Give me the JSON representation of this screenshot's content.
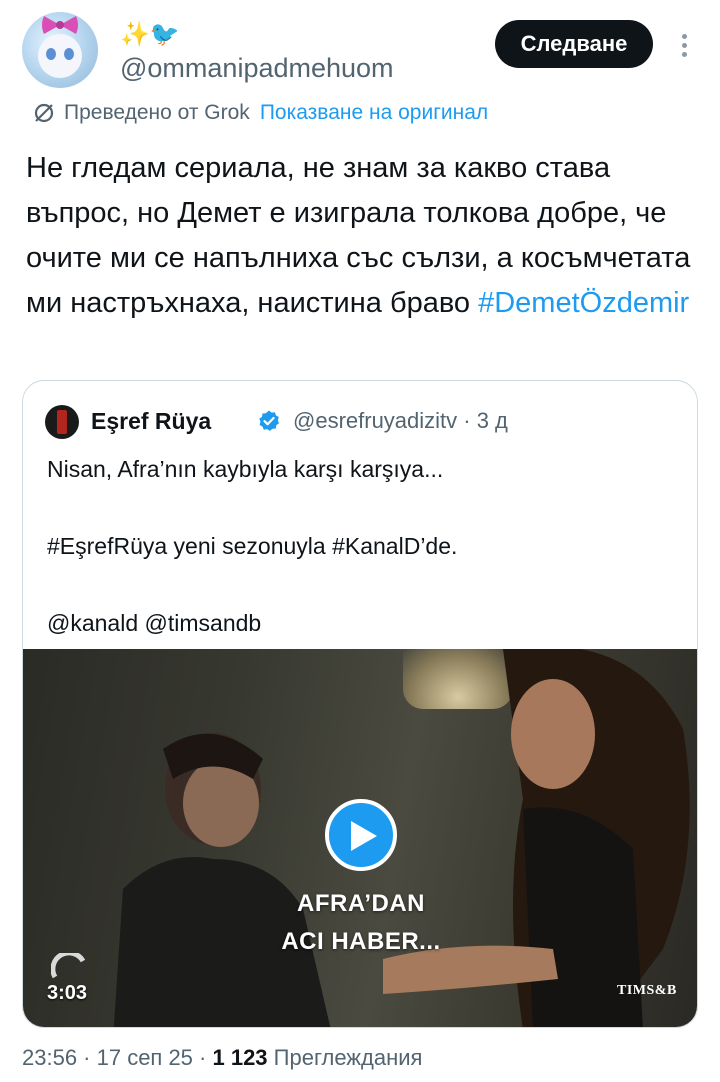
{
  "author": {
    "display_name": "✨🐦",
    "handle": "@ommanipadmehuom"
  },
  "actions": {
    "follow_label": "Следване"
  },
  "translation": {
    "via_label": "Преведено от Grok",
    "show_original_label": "Показване на оригинал"
  },
  "tweet": {
    "text": " Не гледам сериала, не знам за какво става въпрос, но Демет е изиграла толкова добре, че очите ми се напълниха със сълзи, а косъмчетата ми настръхнаха, наистина браво ",
    "hashtag": "#DemetÖzdemir"
  },
  "quote": {
    "name": "Eşref Rüya",
    "handle_time": "@esrefruyadizitv · 3 д",
    "lines": [
      "Nisan, Afra’nın kaybıyla karşı karşıya...",
      "#EşrefRüya yeni sezonuyla #KanalD’de.",
      "@kanald @timsandb"
    ],
    "media": {
      "overlay_line1": "AFRA’DAN",
      "overlay_line2": "ACI HABER...",
      "duration": "3:03",
      "brand": "TIMS&B"
    }
  },
  "footer": {
    "time_date": "23:56 · 17 сеп 25 · ",
    "views_count": "1 123",
    "views_label": " Преглеждания"
  },
  "colors": {
    "accent": "#1d9bf0",
    "text_primary": "#0f1419",
    "text_secondary": "#536471",
    "border": "#cfd9de"
  }
}
